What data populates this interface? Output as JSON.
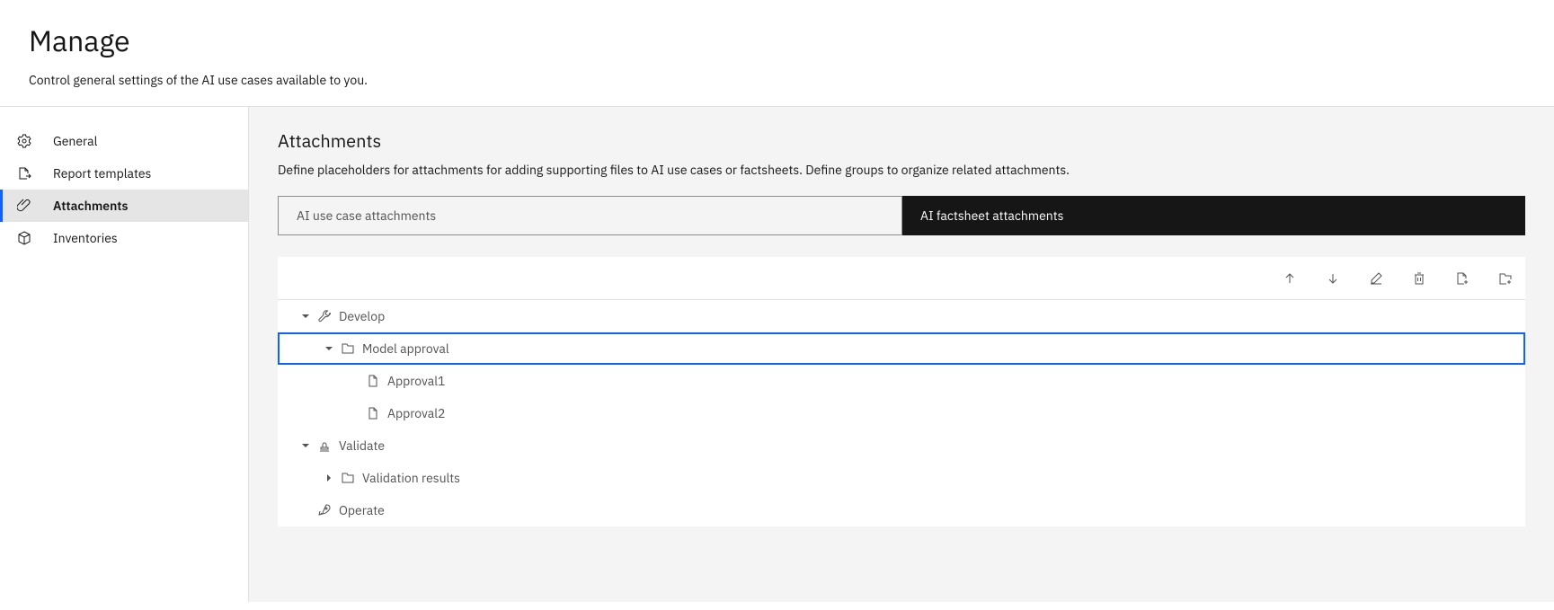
{
  "header": {
    "title": "Manage",
    "subtitle": "Control general settings of the AI use cases available to you."
  },
  "sidebar": {
    "items": [
      {
        "label": "General"
      },
      {
        "label": "Report templates"
      },
      {
        "label": "Attachments"
      },
      {
        "label": "Inventories"
      }
    ]
  },
  "main": {
    "title": "Attachments",
    "description": "Define placeholders for attachments for adding supporting files to AI use cases or factsheets. Define groups to organize related attachments.",
    "tabs": [
      {
        "label": "AI use case attachments"
      },
      {
        "label": "AI factsheet attachments"
      }
    ],
    "tree": {
      "develop": "Develop",
      "model_approval": "Model approval",
      "approval1": "Approval1",
      "approval2": "Approval2",
      "validate": "Validate",
      "validation_results": "Validation results",
      "operate": "Operate"
    }
  }
}
